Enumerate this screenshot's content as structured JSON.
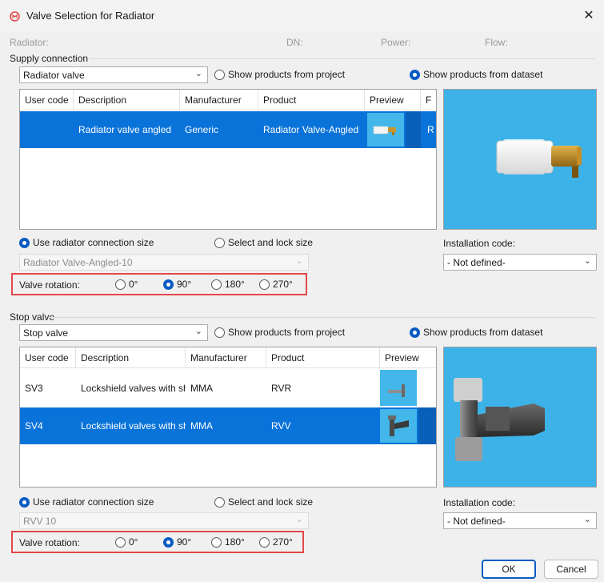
{
  "window": {
    "title": "Valve Selection for Radiator",
    "close_glyph": "✕"
  },
  "info": {
    "radiator": "Radiator:",
    "dn": "DN:",
    "power": "Power:",
    "flow": "Flow:"
  },
  "colors": {
    "accent": "#0a73d9",
    "highlight_border": "#e2484a",
    "preview_bg": "#3db2e8"
  },
  "supply": {
    "section_title": "Supply connection",
    "type_value": "Radiator valve",
    "source_project": "Show products from project",
    "source_dataset": "Show products from dataset",
    "source_selected": "dataset",
    "columns": [
      "User code",
      "Description",
      "Manufacturer",
      "Product",
      "Preview",
      "F"
    ],
    "rows": [
      {
        "user_code": "",
        "description": "Radiator valve angled",
        "manufacturer": "Generic",
        "product": "Radiator Valve-Angled",
        "preview_icon": "radiator-valve-thumb-icon",
        "extra": "R",
        "selected": true
      }
    ],
    "size_option_use": "Use radiator connection size",
    "size_option_lock": "Select and lock size",
    "size_value": "Radiator Valve-Angled-10",
    "rotation_label": "Valve rotation:",
    "rotations": [
      "0°",
      "90°",
      "180°",
      "270°"
    ],
    "rotation_selected": "90°",
    "installation_label": "Installation code:",
    "installation_value": "- Not defined-"
  },
  "stop": {
    "section_title": "Stop valve",
    "type_value": "Stop valve",
    "source_project": "Show products from project",
    "source_dataset": "Show products from dataset",
    "source_selected": "dataset",
    "columns": [
      "User code",
      "Description",
      "Manufacturer",
      "Product",
      "Preview"
    ],
    "rows": [
      {
        "user_code": "SV3",
        "description": "Lockshield valves with sh...",
        "manufacturer": "MMA",
        "product": "RVR",
        "preview_icon": "lockshield-valve-thumb-icon",
        "selected": false
      },
      {
        "user_code": "SV4",
        "description": "Lockshield valves with sh...",
        "manufacturer": "MMA",
        "product": "RVV",
        "preview_icon": "lockshield-valve-thumb-icon",
        "selected": true
      }
    ],
    "size_option_use": "Use radiator connection size",
    "size_option_lock": "Select and lock size",
    "size_value": "RVV 10",
    "rotation_label": "Valve rotation:",
    "rotations": [
      "0°",
      "90°",
      "180°",
      "270°"
    ],
    "rotation_selected": "90°",
    "installation_label": "Installation code:",
    "installation_value": "- Not defined-"
  },
  "buttons": {
    "ok": "OK",
    "cancel": "Cancel"
  }
}
